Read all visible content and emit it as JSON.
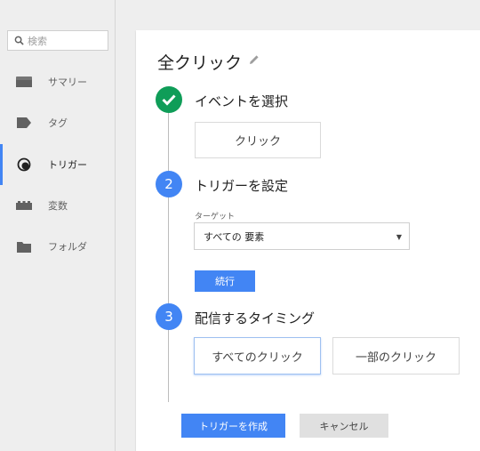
{
  "sidebar": {
    "search": {
      "placeholder": "検索",
      "icon": "search-icon"
    },
    "items": [
      {
        "label": "サマリー",
        "icon": "summary-icon",
        "active": false
      },
      {
        "label": "タグ",
        "icon": "tag-icon",
        "active": false
      },
      {
        "label": "トリガー",
        "icon": "trigger-icon",
        "active": true
      },
      {
        "label": "変数",
        "icon": "variable-icon",
        "active": false
      },
      {
        "label": "フォルダ",
        "icon": "folder-icon",
        "active": false
      }
    ]
  },
  "panel": {
    "title": "全クリック",
    "edit_icon": "pencil-icon",
    "steps": [
      {
        "marker": "✓",
        "title": "イベントを選択",
        "status": "done"
      },
      {
        "marker": "2",
        "title": "トリガーを設定",
        "status": "current"
      },
      {
        "marker": "3",
        "title": "配信するタイミング",
        "status": "current"
      }
    ],
    "event_button": "クリック",
    "target_label": "ターゲット",
    "target_value": "すべての 要素",
    "continue_button": "続行",
    "timing_options": [
      "すべてのクリック",
      "一部のクリック"
    ],
    "timing_selected": "すべてのクリック",
    "create_button": "トリガーを作成",
    "cancel_button": "キャンセル"
  },
  "colors": {
    "accent": "#4285f4",
    "success": "#0f9d58",
    "sidebar_bg": "#eeeeee",
    "active_indicator": "#4285f4"
  }
}
